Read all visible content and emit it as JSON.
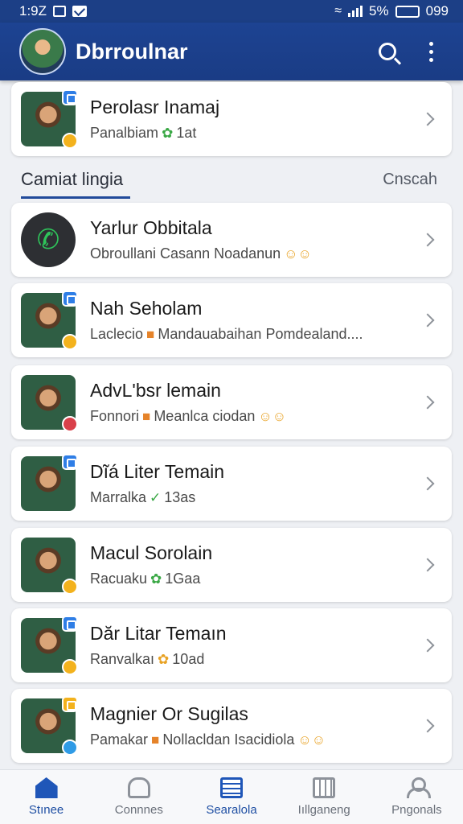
{
  "status_bar": {
    "time": "1:9Z",
    "battery_percent": "5%",
    "battery_value": "099"
  },
  "app_bar": {
    "title": "Dbrroulnar"
  },
  "featured": {
    "title": "Perolasr Inamaj",
    "subtitle": "Panalbiam",
    "meta": "1at"
  },
  "section": {
    "title": "Camiat lingia",
    "action": "Cnscah"
  },
  "contacts": [
    {
      "title": "Yarlur Obbitala",
      "subtitle": "Obroullani Casann Noadanun",
      "meta": ""
    },
    {
      "title": "Nah Seholam",
      "subtitle": "Laclecio",
      "meta": "Mandauabaihan Pomdealand...."
    },
    {
      "title": "AdvL'bsr lemain",
      "subtitle": "Fonnori",
      "meta": "Meanlca ciodan"
    },
    {
      "title": "Dĩá Liter Temain",
      "subtitle": "Marralka",
      "meta": "13as"
    },
    {
      "title": "Macul Sorolain",
      "subtitle": "Racuaku",
      "meta": "1Gaa"
    },
    {
      "title": "Dăr Litar Temaın",
      "subtitle": "Ranvalkaı",
      "meta": "10ad"
    },
    {
      "title": "Magnier Or Sugilas",
      "subtitle": "Pamakar",
      "meta": "Nollacldan Isacidiola"
    }
  ],
  "bottom_nav": [
    {
      "label": "Stınee",
      "icon": "home-icon",
      "active": true
    },
    {
      "label": "Connnes",
      "icon": "chat-icon",
      "active": false
    },
    {
      "label": "Searalola",
      "icon": "list-icon",
      "active": true
    },
    {
      "label": "Iıllganeng",
      "icon": "grid-icon",
      "active": false
    },
    {
      "label": "Pngonals",
      "icon": "user-icon",
      "active": false
    }
  ]
}
